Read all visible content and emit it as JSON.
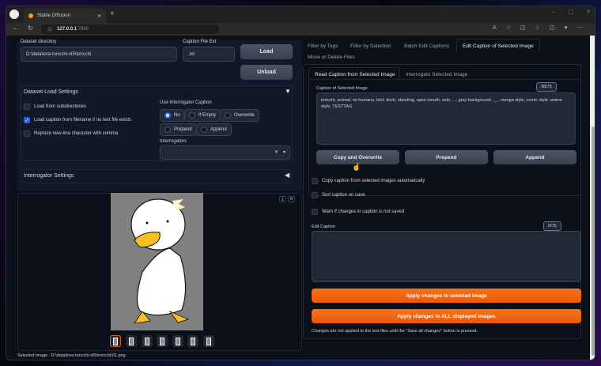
{
  "browser": {
    "tab_title": "Stable Diffusion",
    "url_host": "127.0.0.1",
    "url_port": ":7860"
  },
  "dataset": {
    "dir_label": "Dataset directory",
    "dir_value": "D:\\data\\lora-toricchi-xl5\\toricchi",
    "ext_label": "Caption File Ext",
    "ext_value": ".txt",
    "load": "Load",
    "unload": "Unload"
  },
  "load_settings": {
    "title": "Dataset Load Settings",
    "checkboxes": [
      {
        "label": "Load from subdirectories",
        "checked": false
      },
      {
        "label": "Load caption from filename if no text file exists",
        "checked": true
      },
      {
        "label": "Replace new-line character with comma",
        "checked": false
      }
    ],
    "interrogator_caption_label": "Use Interrogator Caption",
    "radios": [
      {
        "label": "No",
        "selected": true
      },
      {
        "label": "If Empty",
        "selected": false
      },
      {
        "label": "Overwrite",
        "selected": false
      },
      {
        "label": "Prepend",
        "selected": false
      },
      {
        "label": "Append",
        "selected": false
      }
    ],
    "interrogators_label": "Interrogators"
  },
  "interrogator_settings": {
    "title": "Interrogator Settings"
  },
  "gallery": {
    "thumb_count": 7,
    "selected_text": "Selected Image : D:\\data\\lora-toricchi-xl5\\toricchi\\01.png"
  },
  "tabs": [
    {
      "label": "Filter by Tags"
    },
    {
      "label": "Filter by Selection"
    },
    {
      "label": "Batch Edit Captions"
    },
    {
      "label": "Edit Caption of Selected Image",
      "active": true
    },
    {
      "label": "Move or Delete Files"
    }
  ],
  "subtabs": [
    {
      "label": "Read Caption from Selected Image",
      "active": true
    },
    {
      "label": "Interrogate Selected Image"
    }
  ],
  "caption": {
    "label": "Caption of Selected Image",
    "counter": "38/75",
    "text": "toricchi, animal, no humans, bird, duck, standing, open mouth, solo, ..., gray background, ._., manga style, comic style, anime style, TESTTAG",
    "copy": "Copy and Overwrite",
    "prepend": "Prepend",
    "append": "Append"
  },
  "options": [
    {
      "label": "Copy caption from selected images automatically"
    },
    {
      "label": "Sort caption on save"
    },
    {
      "label": "Warn if changes in caption is not saved"
    }
  ],
  "edit": {
    "label": "Edit Caption",
    "counter": "0/75",
    "apply_selected": "Apply changes to selected image",
    "apply_all": "Apply changes to ALL displayed images",
    "note": "Changes are not applied to the text files until the \"Save all changes\" button is pressed."
  },
  "colors": {
    "accent": "#f97316",
    "bg": "#0b0f19"
  }
}
